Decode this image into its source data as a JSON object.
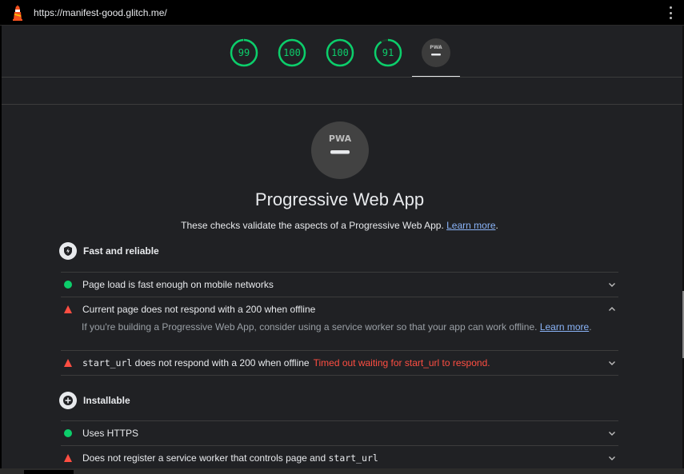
{
  "browser": {
    "url": "https://manifest-good.glitch.me/",
    "logo_icon": "lighthouse-icon",
    "menu_icon": "kebab-menu-icon"
  },
  "gauges": [
    {
      "label": "99",
      "score": 0.99,
      "color": "#0cce6b"
    },
    {
      "label": "100",
      "score": 1.0,
      "color": "#0cce6b"
    },
    {
      "label": "100",
      "score": 1.0,
      "color": "#0cce6b"
    },
    {
      "label": "91",
      "score": 0.91,
      "color": "#0cce6b"
    }
  ],
  "pwa_badge": {
    "text": "PWA"
  },
  "category": {
    "title": "Progressive Web App",
    "description": "These checks validate the aspects of a Progressive Web App.",
    "learn_more": "Learn more",
    "description_end": "."
  },
  "groups": {
    "fast": {
      "title": "Fast and reliable",
      "icon": "lightning-shield-icon"
    },
    "installable": {
      "title": "Installable",
      "icon": "plus-circle-icon"
    }
  },
  "audits": {
    "page_load": {
      "text": "Page load is fast enough on mobile networks",
      "status": "pass"
    },
    "offline": {
      "text": "Current page does not respond with a 200 when offline",
      "status": "fail",
      "detail": "If you're building a Progressive Web App, consider using a service worker so that your app can work offline.",
      "detail_link": "Learn more",
      "detail_end": "."
    },
    "start_url": {
      "code": "start_url",
      "text": " does not respond with a 200 when offline",
      "error": "Timed out waiting for start_url to respond.",
      "status": "fail"
    },
    "https": {
      "text": "Uses HTTPS",
      "status": "pass"
    },
    "sw": {
      "text": "Does not register a service worker that controls page and ",
      "code": "start_url",
      "status": "fail"
    }
  },
  "colors": {
    "pass": "#0cce6b",
    "fail": "#ff4e42",
    "background": "#202124",
    "link": "#8ab4f8"
  }
}
